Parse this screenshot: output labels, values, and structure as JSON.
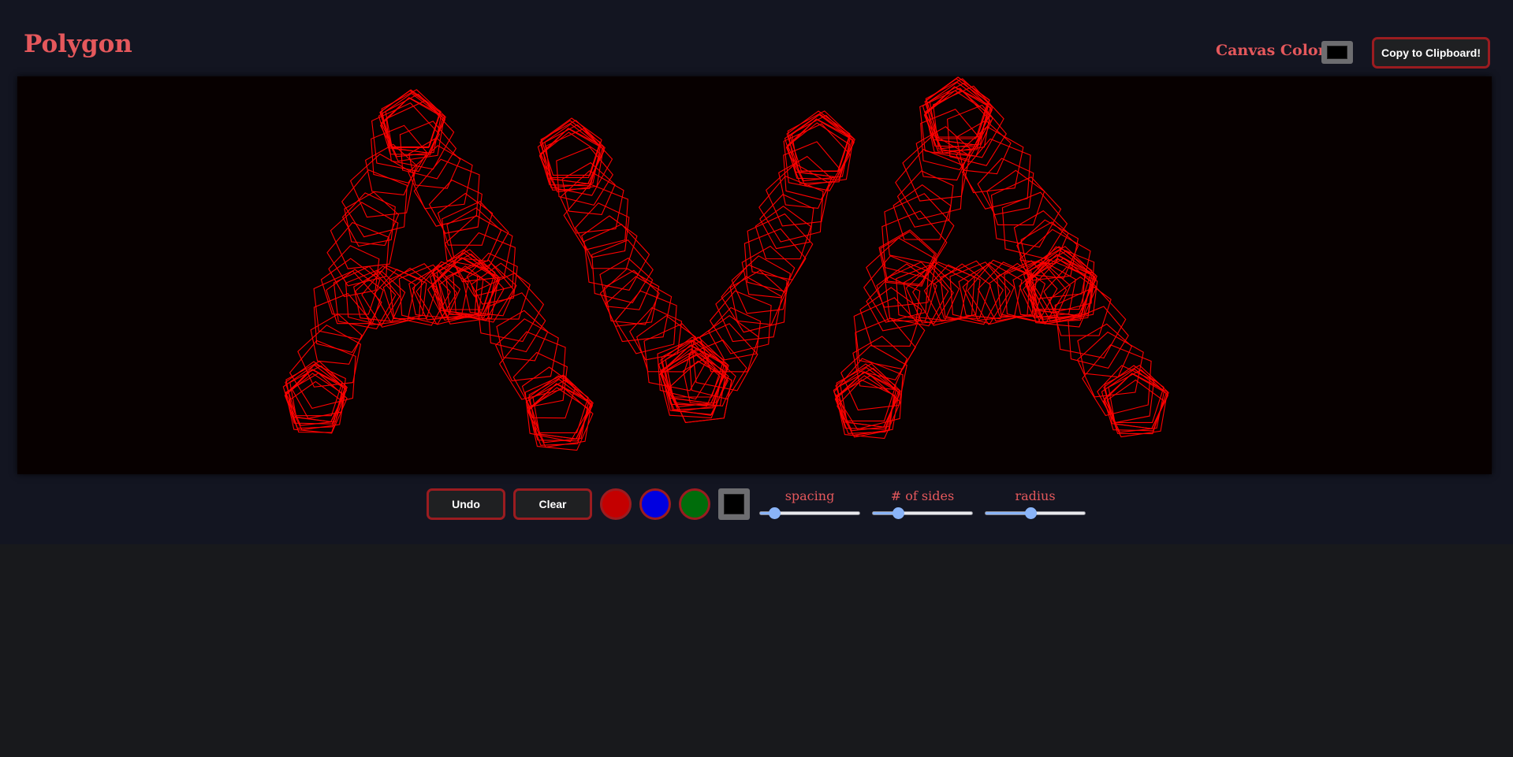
{
  "app": {
    "title": "Polygon",
    "canvas_color_label": "Canvas Color:",
    "canvas_color": "#000000",
    "copy_button_label": "Copy to Clipboard!",
    "accent_color": "#e5585c",
    "border_color": "#9b1c20",
    "background_color": "#131521"
  },
  "drawing": {
    "text": "AVA",
    "stroke_color": "#ff0000",
    "shape": "pentagon"
  },
  "toolbar": {
    "undo_label": "Undo",
    "clear_label": "Clear",
    "colors": [
      {
        "name": "red",
        "value": "#c40000"
      },
      {
        "name": "blue",
        "value": "#0000e0"
      },
      {
        "name": "green",
        "value": "#006d0b"
      }
    ],
    "picker_color": "#000000",
    "sliders": [
      {
        "name": "spacing",
        "label": "spacing",
        "value_fraction": 0.14
      },
      {
        "name": "sides",
        "label": "# of sides",
        "value_fraction": 0.25
      },
      {
        "name": "radius",
        "label": "radius",
        "value_fraction": 0.45
      }
    ]
  }
}
